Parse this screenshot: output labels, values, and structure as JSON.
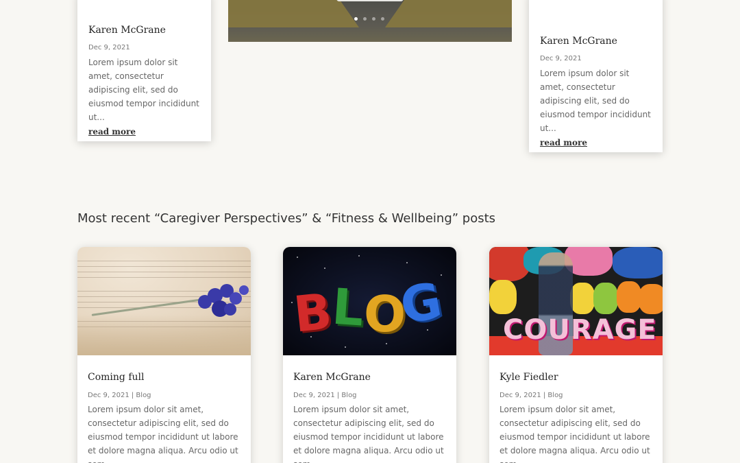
{
  "top_cards": [
    {
      "title": "Karen McGrane",
      "date": "Dec 9, 2021",
      "excerpt": "Lorem ipsum dolor sit amet, consectetur adipiscing elit, sed do eiusmod tempor incididunt ut...",
      "read_more": "read more"
    },
    {
      "title": "Karen McGrane",
      "date": "Dec 9, 2021",
      "excerpt": "Lorem ipsum dolor sit amet, consectetur adipiscing elit, sed do eiusmod tempor incididunt ut...",
      "read_more": "read more"
    }
  ],
  "slider": {
    "dot_count": 4,
    "active_dot": 0
  },
  "section": {
    "heading": "Most recent “Caregiver Perspectives” & “Fitness & Wellbeing” posts"
  },
  "posts": [
    {
      "image_icon": "sheet-music-flower-image",
      "title": "Coming full",
      "meta": "Dec 9, 2021 | Blog",
      "excerpt": "Lorem ipsum dolor sit amet, consectetur adipiscing elit, sed do eiusmod tempor incididunt ut labore et dolore magna aliqua. Arcu odio ut sem"
    },
    {
      "image_icon": "blog-letters-image",
      "image_text": [
        "B",
        "L",
        "O",
        "G"
      ],
      "title": "Karen McGrane",
      "meta": "Dec 9, 2021 | Blog",
      "excerpt": "Lorem ipsum dolor sit amet, consectetur adipiscing elit, sed do eiusmod tempor incididunt ut labore et dolore magna aliqua. Arcu odio ut sem"
    },
    {
      "image_icon": "courage-graffiti-image",
      "image_text": "COURAGE",
      "title": "Kyle Fiedler",
      "meta": "Dec 9, 2021 | Blog",
      "excerpt": "Lorem ipsum dolor sit amet, consectetur adipiscing elit, sed do eiusmod tempor incididunt ut labore et dolore magna aliqua. Arcu odio ut sem"
    }
  ],
  "colors": {
    "background": "#f8f7f3",
    "card": "#ffffff",
    "text": "#333333",
    "muted": "#777777"
  }
}
